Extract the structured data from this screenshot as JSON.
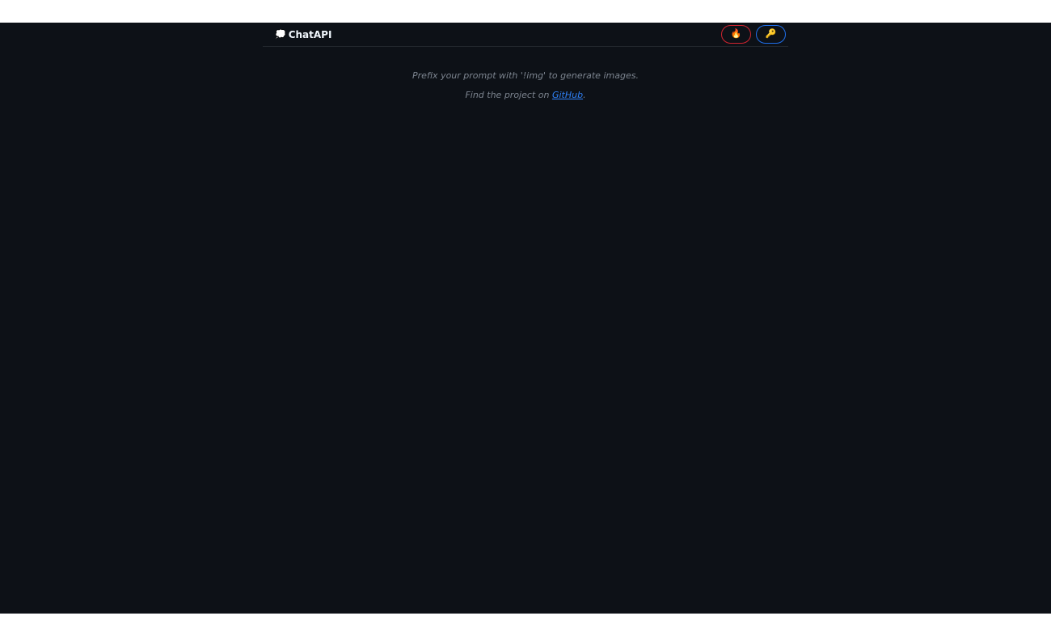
{
  "header": {
    "logo_icon": "💭",
    "title": "ChatAPI",
    "reset_button_icon": "🔥",
    "key_button_icon": "🔑"
  },
  "notes": {
    "line1": "Prefix your prompt with '!img' to generate images.",
    "line2_prefix": "Find the project on ",
    "line2_link": "GitHub",
    "line2_suffix": "."
  },
  "colors": {
    "background": "#0d1117",
    "reset_border": "#d1242f",
    "key_border": "#1f6feb",
    "link": "#2f81f7"
  }
}
